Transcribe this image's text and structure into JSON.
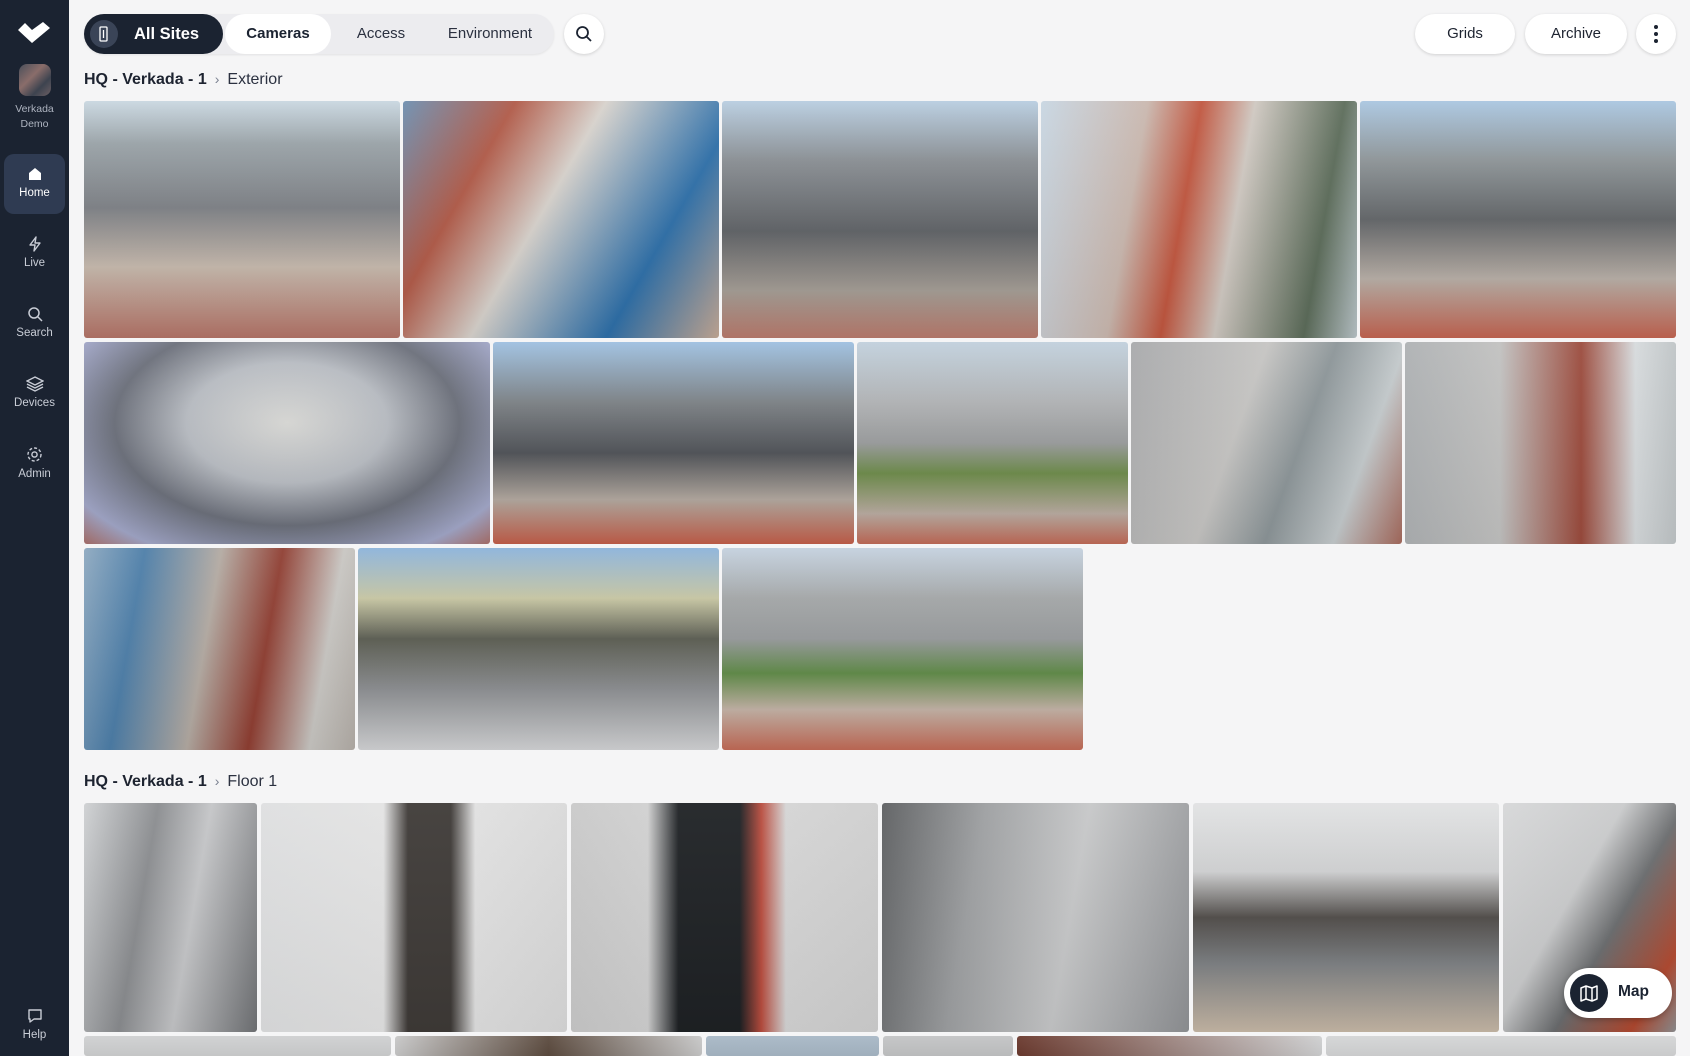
{
  "sidebar": {
    "org_name_line1": "Verkada",
    "org_name_line2": "Demo",
    "items": [
      {
        "label": "Home",
        "icon": "home-icon",
        "active": true
      },
      {
        "label": "Live",
        "icon": "bolt-icon",
        "active": false
      },
      {
        "label": "Search",
        "icon": "search-icon",
        "active": false
      },
      {
        "label": "Devices",
        "icon": "devices-icon",
        "active": false
      },
      {
        "label": "Admin",
        "icon": "gear-icon",
        "active": false
      }
    ],
    "help_label": "Help"
  },
  "topbar": {
    "all_sites": "All Sites",
    "tabs": [
      "Cameras",
      "Access",
      "Environment"
    ],
    "active_tab": "Cameras",
    "grids": "Grids",
    "archive": "Archive"
  },
  "sections": [
    {
      "site": "HQ - Verkada - 1",
      "area": "Exterior"
    },
    {
      "site": "HQ - Verkada - 1",
      "area": "Floor 1"
    }
  ],
  "map_button": "Map",
  "colors": {
    "sidebar": "#1b2331",
    "active_nav": "#2f3b52",
    "background": "#f5f5f6"
  }
}
